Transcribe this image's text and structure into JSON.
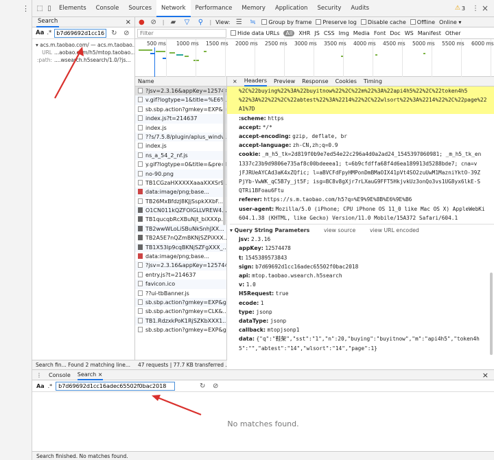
{
  "toolbar": {
    "tabs": [
      "Elements",
      "Console",
      "Sources",
      "Network",
      "Performance",
      "Memory",
      "Application",
      "Security",
      "Audits"
    ],
    "active_tab": "Network",
    "warning_count": "3"
  },
  "search_panel": {
    "tab": "Search",
    "query": "b7d69692d1cc16adec65502f0bac2018",
    "aa": "Aa",
    "regex": ".*",
    "result_host": "acs.m.taobao.com/ — acs.m.taobao...",
    "result_url_label": "URL",
    "result_url": "...aobao.com/h5/mtop.taobao...",
    "result_path_label": ":path:",
    "result_path": "....wsearch.h5search/1.0/?js...",
    "footer": "Search fin...  Found 2 matching line..."
  },
  "network_toolbar": {
    "view_label": "View:",
    "group_by_frame": "Group by frame",
    "preserve_log": "Preserve log",
    "disable_cache": "Disable cache",
    "offline": "Offline",
    "throttle": "Online"
  },
  "filter_bar": {
    "placeholder": "Filter",
    "hide_data_urls": "Hide data URLs",
    "types": [
      "All",
      "XHR",
      "JS",
      "CSS",
      "Img",
      "Media",
      "Font",
      "Doc",
      "WS",
      "Manifest",
      "Other"
    ]
  },
  "timeline": {
    "ticks": [
      "500 ms",
      "1000 ms",
      "1500 ms",
      "2000 ms",
      "2500 ms",
      "3000 ms",
      "3500 ms",
      "4000 ms",
      "4500 ms",
      "5000 ms",
      "5500 ms",
      "6000 ms"
    ]
  },
  "requests": {
    "header": "Name",
    "rows": [
      {
        "name": "?jsv=2.3.16&appKey=125744...",
        "icon": "file",
        "selected": true
      },
      {
        "name": "v.gif?logtype=1&title=%E6%...",
        "icon": "file"
      },
      {
        "name": "sb.sbp.action?gmkey=EXP&g...",
        "icon": "file"
      },
      {
        "name": "index.js?t=214637",
        "icon": "file"
      },
      {
        "name": "index.js",
        "icon": "file"
      },
      {
        "name": "??s/7.5.8/plugin/aplus_windv...",
        "icon": "file"
      },
      {
        "name": "index.js",
        "icon": "file"
      },
      {
        "name": "ns_a_54_2_nf.js",
        "icon": "file"
      },
      {
        "name": "y.gif?logtype=0&title=&pre=ht...",
        "icon": "file"
      },
      {
        "name": "no-90.png",
        "icon": "file"
      },
      {
        "name": "TB1CGzaHXXXXXaaaXXXSr9...",
        "icon": "file"
      },
      {
        "name": "data:image/png;base...",
        "icon": "img"
      },
      {
        "name": "TB26MxBfdzJ8KJjSspkXXbF...",
        "icon": "file"
      },
      {
        "name": "O1CN011kQZFOIGLLVREW4...",
        "icon": "dark"
      },
      {
        "name": "TB1qucqbRcXBuNjt_biXXXp...",
        "icon": "dark"
      },
      {
        "name": "TB2wwWLoLiSBuNkSnhJXX...",
        "icon": "dark"
      },
      {
        "name": "TB2A5E7nQZmBKNjSZPiXXX...",
        "icon": "dark"
      },
      {
        "name": "TB1X53lp9cqBKNjSZFgXXX_...",
        "icon": "dark"
      },
      {
        "name": "data:image/png;base...",
        "icon": "img"
      },
      {
        "name": "?jsv=2.3.16&appKey=125744...",
        "icon": "file"
      },
      {
        "name": "entry.js?t=214637",
        "icon": "file"
      },
      {
        "name": "favicon.ico",
        "icon": "file"
      },
      {
        "name": "??ui-tbBanner.js",
        "icon": "file"
      },
      {
        "name": "sb.sbp.action?gmkey=EXP&g...",
        "icon": "file"
      },
      {
        "name": "sb.sbp.action?gmkey=CLK&...",
        "icon": "file"
      },
      {
        "name": "TB1.RdzxkPoK1RjSZKbXXX1...",
        "icon": "file"
      },
      {
        "name": "sb.sbp.action?gmkey=EXP&g...",
        "icon": "file"
      }
    ],
    "footer": "47 requests | 77.7 KB transferred ..."
  },
  "headers_pane": {
    "close": "×",
    "tabs": [
      "Headers",
      "Preview",
      "Response",
      "Cookies",
      "Timing"
    ],
    "active_tab": "Headers",
    "highlighted_lines": [
      "%2C%22buying%22%3A%22buyitnow%22%2C%22m%22%3A%22api4h5%22%2C%22token4h5",
      "%22%3A%22%22%2C%22abtest%22%3A%2214%22%2C%22wlsort%22%3A%2214%22%2C%22page%22",
      "A1%7D"
    ],
    "request_headers": [
      {
        "k": ":scheme:",
        "v": "https"
      },
      {
        "k": "accept:",
        "v": "*/*"
      },
      {
        "k": "accept-encoding:",
        "v": "gzip, deflate, br"
      },
      {
        "k": "accept-language:",
        "v": "zh-CN,zh;q=0.9"
      },
      {
        "k": "cookie:",
        "v": "_m_h5_tk=2d819f0b9e7ed54e22c296a4d0a2ad24_1545397060981; _m_h5_tk_en"
      },
      {
        "k": "",
        "v": "1337c23b9d9806e735af8c00bdeeea1; t=6b9cfdffa68f4d6ea189913d5288bde7; cna=v"
      },
      {
        "k": "",
        "v": "jFJRUeAYCAd3aK4xZQfic; l=aBVCFdFpyHMPonDmBMaOIX41pVt4SO2zuUwM1MazniYktO-39Z"
      },
      {
        "k": "",
        "v": "PjYb-VwWK_qC5B7y_jt5F; isg=BC8v8gXjr7rLXauG9FFT5HkjvkUz3onQo3vs1UG8yx6lkE-S"
      },
      {
        "k": "",
        "v": "QTRi1BFoau6Ftu"
      },
      {
        "k": "referer:",
        "v": "https://s.m.taobao.com/h5?q=%E9%9E%8B%E6%9E%B6"
      },
      {
        "k": "user-agent:",
        "v": "Mozilla/5.0 (iPhone; CPU iPhone OS 11_0 like Mac OS X) AppleWebKi"
      },
      {
        "k": "",
        "v": "604.1.38 (KHTML, like Gecko) Version/11.0 Mobile/15A372 Safari/604.1"
      }
    ],
    "qsp_title": "Query String Parameters",
    "qsp_view_source": "view source",
    "qsp_view_encoded": "view URL encoded",
    "query_params": [
      {
        "k": "jsv:",
        "v": "2.3.16"
      },
      {
        "k": "appKey:",
        "v": "12574478"
      },
      {
        "k": "t:",
        "v": "1545389573843"
      },
      {
        "k": "sign:",
        "v": "b7d69692d1cc16adec65502f0bac2018"
      },
      {
        "k": "api:",
        "v": "mtop.taobao.wsearch.h5search"
      },
      {
        "k": "v:",
        "v": "1.0"
      },
      {
        "k": "H5Request:",
        "v": "true"
      },
      {
        "k": "ecode:",
        "v": "1"
      },
      {
        "k": "type:",
        "v": "jsonp"
      },
      {
        "k": "dataType:",
        "v": "jsonp"
      },
      {
        "k": "callback:",
        "v": "mtopjsonp1"
      },
      {
        "k": "data:",
        "v": "{\"q\":\"鞋架\",\"sst\":\"1\",\"n\":20,\"buying\":\"buyitnow\",\"m\":\"api4h5\",\"token4h"
      },
      {
        "k": "",
        "v": "5\":\"\",\"abtest\":\"14\",\"wlsort\":\"14\",\"page\":1}"
      }
    ]
  },
  "drawer": {
    "tabs": [
      "Console",
      "Search ×"
    ],
    "active_tab": "Search ×",
    "aa": "Aa",
    "regex": ".*",
    "query": "b7d69692d1cc16adec65502f0bac2018",
    "no_matches": "No matches found.",
    "footer": "Search finished.  No matches found.",
    "close": "×"
  },
  "colors": {
    "accent": "#1a73e8",
    "highlight": "#fffd8e",
    "annotation_arrow": "#d9302c"
  }
}
